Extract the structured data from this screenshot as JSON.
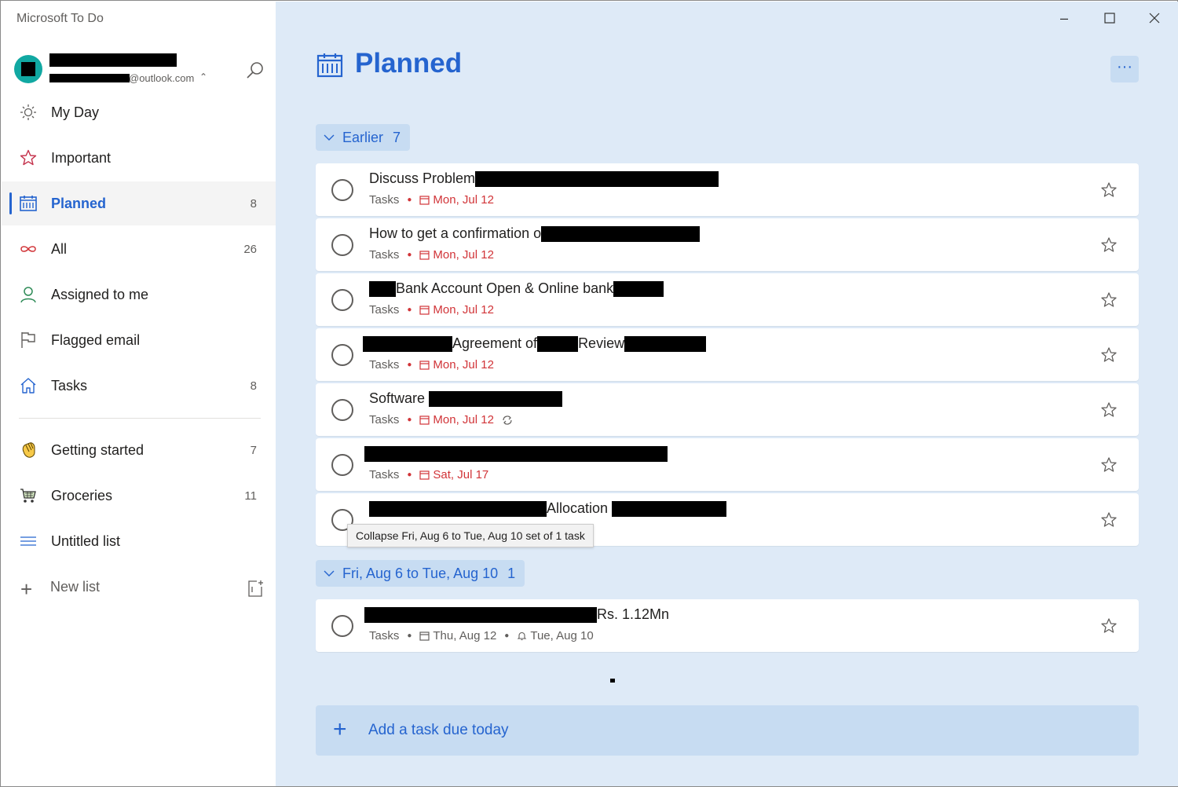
{
  "app": {
    "title": "Microsoft To Do"
  },
  "account": {
    "email_suffix": "@outlook.com"
  },
  "sidebar": {
    "items": [
      {
        "label": "My Day",
        "count": "",
        "icon": "sun-icon"
      },
      {
        "label": "Important",
        "count": "",
        "icon": "star-icon"
      },
      {
        "label": "Planned",
        "count": "8",
        "icon": "calendar-icon",
        "active": true
      },
      {
        "label": "All",
        "count": "26",
        "icon": "infinity-icon"
      },
      {
        "label": "Assigned to me",
        "count": "",
        "icon": "person-icon"
      },
      {
        "label": "Flagged email",
        "count": "",
        "icon": "flag-icon"
      },
      {
        "label": "Tasks",
        "count": "8",
        "icon": "home-icon"
      }
    ],
    "lists": [
      {
        "label": "Getting started",
        "count": "7",
        "icon": "waving-hand-emoji"
      },
      {
        "label": "Groceries",
        "count": "11",
        "icon": "shopping-cart-emoji"
      },
      {
        "label": "Untitled list",
        "count": "",
        "icon": "list-lines-icon"
      }
    ],
    "new_list_label": "New list"
  },
  "main": {
    "title": "Planned",
    "more_label": "···",
    "groups": [
      {
        "label": "Earlier",
        "count": "7"
      },
      {
        "label": "Fri, Aug 6 to Tue, Aug 10",
        "count": "1"
      }
    ],
    "tasks": [
      {
        "title": "Discuss Problem",
        "list": "Tasks",
        "due": "Mon, Jul 12"
      },
      {
        "title": "How to get a confirmation o",
        "list": "Tasks",
        "due": "Mon, Jul 12"
      },
      {
        "title": "Bank Account Open & Online bank",
        "list": "Tasks",
        "due": "Mon, Jul 12"
      },
      {
        "title_a": "Agreement of",
        "title_b": "Review",
        "list": "Tasks",
        "due": "Mon, Jul 12"
      },
      {
        "title": "Software",
        "list": "Tasks",
        "due": "Mon, Jul 12",
        "repeat": true
      },
      {
        "title": "",
        "list": "Tasks",
        "due": "Sat, Jul 17"
      },
      {
        "title": "Allocation",
        "list": "",
        "due": ""
      },
      {
        "title": "Rs. 1.12Mn",
        "list": "Tasks",
        "due": "Thu, Aug 12",
        "reminder": "Tue, Aug 10"
      }
    ],
    "tooltip": "Collapse Fri, Aug 6 to Tue, Aug 10 set of 1 task",
    "add_task_label": "Add a task due today"
  },
  "colors": {
    "accent": "#2564cf",
    "overdue": "#d13438",
    "background": "#deeaf7"
  }
}
